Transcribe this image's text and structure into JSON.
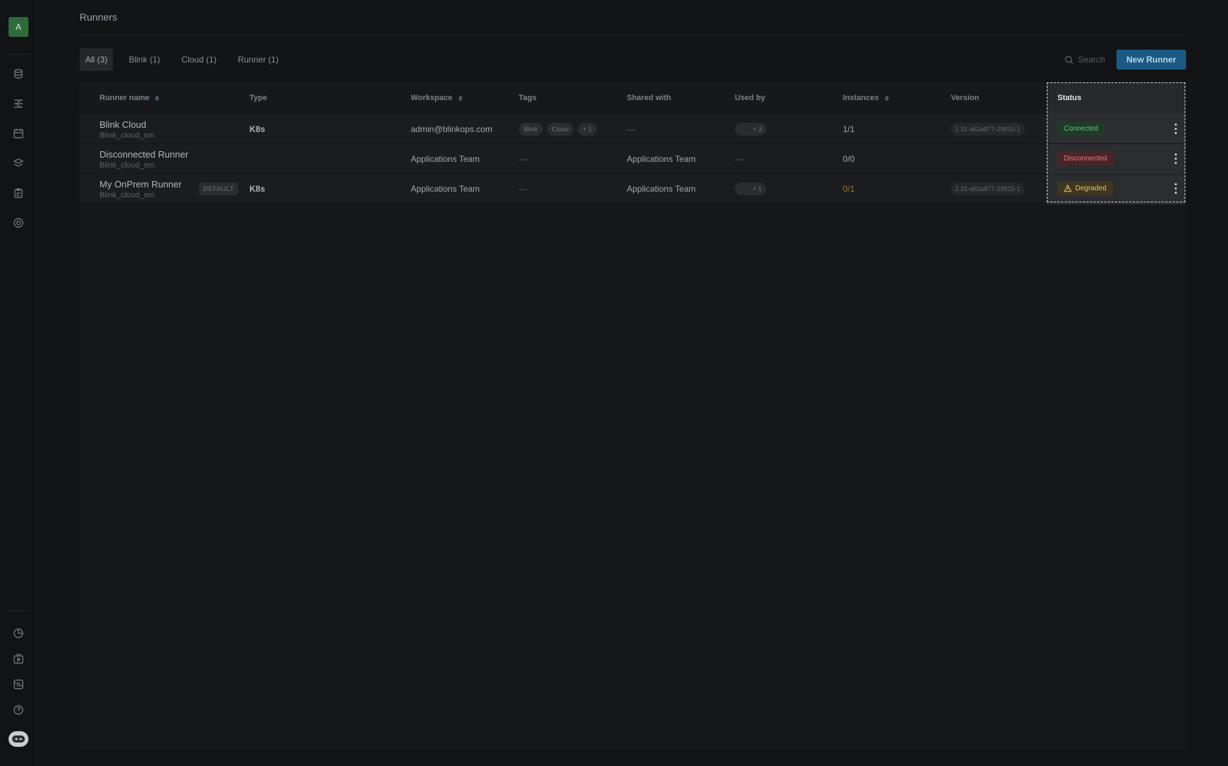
{
  "sidebar": {
    "avatar_initial": "A",
    "top_icons": [
      "agents-icon",
      "workflows-icon",
      "calendar-icon",
      "layers-icon",
      "clipboard-icon",
      "target-icon"
    ],
    "bottom_icons": [
      "chart-icon",
      "play-box-icon",
      "database-icon",
      "help-icon",
      "bot-icon"
    ]
  },
  "header": {
    "title": "Runners"
  },
  "tabs": [
    {
      "label": "All (3)",
      "active": true
    },
    {
      "label": "Blink (1)"
    },
    {
      "label": "Cloud (1)"
    },
    {
      "label": "Runner (1)"
    }
  ],
  "search": {
    "placeholder": "Search"
  },
  "new_runner_label": "New Runner",
  "table": {
    "headers": {
      "runner_name": "Runner name",
      "type": "Type",
      "workspace": "Workspace",
      "tags": "Tags",
      "shared_with": "Shared with",
      "used_by": "Used by",
      "instances": "Instances",
      "version": "Version",
      "status": "Status"
    },
    "rows": [
      {
        "name": "Blink Cloud",
        "sub": "Blink_cloud_sm",
        "default_badge": "",
        "type": "K8s",
        "workspace": "admin@blinkops.com",
        "tags": [
          "Blink",
          "Cloud",
          "+ 1"
        ],
        "shared_with": "—",
        "used_by": "+ 3",
        "instances": "1/1",
        "version": "2.31-a62a877-29815-1",
        "status": "Connected"
      },
      {
        "name": "Disconnected Runner",
        "sub": "Blink_cloud_sm",
        "default_badge": "",
        "type": "",
        "workspace": "Applications Team",
        "tags_dash": "—",
        "shared_with": "Applications Team",
        "used_by_dash": "—",
        "instances": "0/0",
        "version": "",
        "status": "Disconnected"
      },
      {
        "name": "My OnPrem Runner",
        "sub": "Blink_cloud_sm",
        "default_badge": "DEFAULT",
        "type": "K8s",
        "workspace": "Applications Team",
        "tags_dash": "—",
        "shared_with": "Applications Team",
        "used_by": "+ 1",
        "instances": "0/1",
        "version": "2.31-a62a877-29815-1",
        "status": "Degraded"
      }
    ]
  },
  "colors": {
    "connected": "#5fc27a",
    "disconnected": "#e37b7f",
    "degraded": "#e5c463",
    "primary_button": "#1c5a86"
  }
}
